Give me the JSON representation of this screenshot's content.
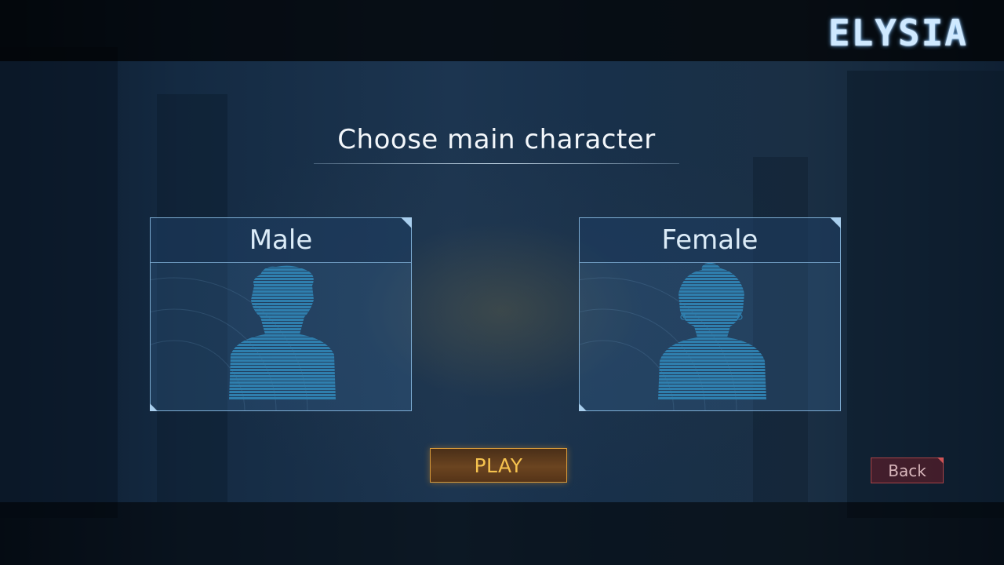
{
  "header": {
    "logo_text": "ELYSIA"
  },
  "title": "Choose main character",
  "characters": [
    {
      "label": "Male",
      "icon": "male-silhouette-icon"
    },
    {
      "label": "Female",
      "icon": "female-silhouette-icon"
    }
  ],
  "buttons": {
    "play_label": "PLAY",
    "back_label": "Back"
  },
  "colors": {
    "accent_blue": "#a9cfee",
    "silhouette": "#2f7fae",
    "play_text": "#f5c24e",
    "back_border": "#c85050"
  }
}
